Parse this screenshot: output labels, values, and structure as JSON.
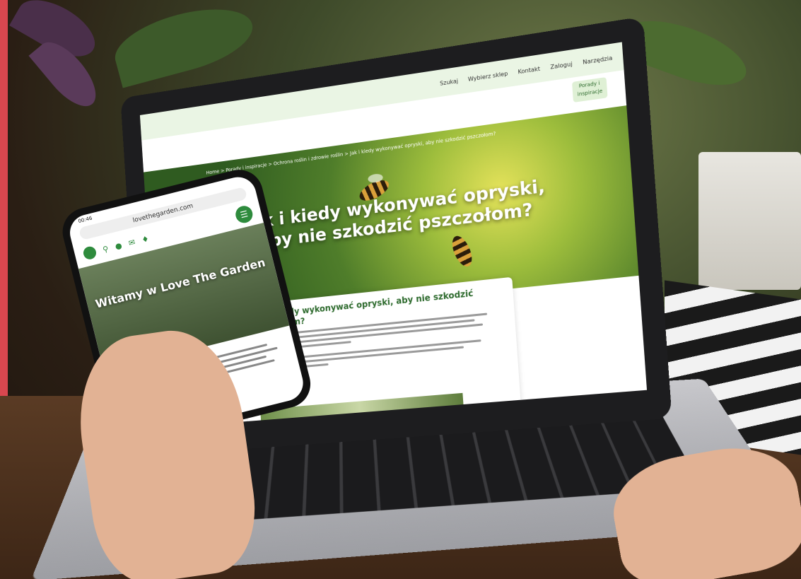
{
  "laptop": {
    "topbar": {
      "items": [
        "Szukaj",
        "Wybierz sklep",
        "Kontakt",
        "Zaloguj",
        "Narzędzia"
      ]
    },
    "advice_button": "Porady i inspiracje",
    "breadcrumb": "Home  >  Porady i inspiracje  >  Ochrona roślin i zdrowie roślin  >  Jak i kiedy wykonywać opryski, aby nie szkodzić pszczołom?",
    "hero_title": "Jak i kiedy wykonywać opryski, aby nie szkodzić pszczołom?",
    "content_title": "Jak i kiedy wykonywać opryski, aby nie szkodzić pszczołom?"
  },
  "phone": {
    "status_time": "00:46",
    "url": "lovethegarden.com",
    "hero_title": "Witamy w Love The Garden",
    "menu_icon": "menu-icon",
    "nav_icons": [
      "search-icon",
      "location-icon",
      "mail-icon",
      "shield-icon"
    ]
  },
  "colors": {
    "brand_green": "#2e8b3d",
    "accent_red": "#d9474f",
    "topbar_bg": "#eaf5e4"
  }
}
